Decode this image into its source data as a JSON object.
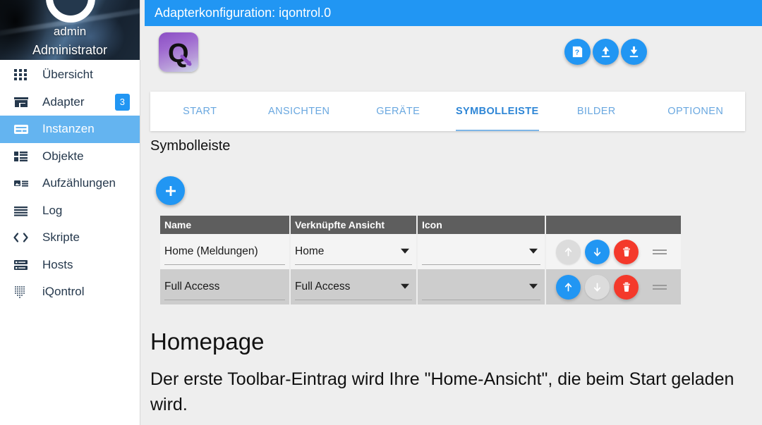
{
  "sidebar": {
    "user": {
      "name": "admin",
      "role": "Administrator"
    },
    "items": [
      {
        "label": "Übersicht",
        "icon": "grid-dots-icon",
        "selected": false,
        "badge": null
      },
      {
        "label": "Adapter",
        "icon": "store-icon",
        "selected": false,
        "badge": "3"
      },
      {
        "label": "Instanzen",
        "icon": "instances-icon",
        "selected": true,
        "badge": null
      },
      {
        "label": "Objekte",
        "icon": "list-blocks-icon",
        "selected": false,
        "badge": null
      },
      {
        "label": "Aufzählungen",
        "icon": "image-list-icon",
        "selected": false,
        "badge": null
      },
      {
        "label": "Log",
        "icon": "lines-icon",
        "selected": false,
        "badge": null
      },
      {
        "label": "Skripte",
        "icon": "code-brackets-icon",
        "selected": false,
        "badge": null
      },
      {
        "label": "Hosts",
        "icon": "server-icon",
        "selected": false,
        "badge": null
      },
      {
        "label": "iQontrol",
        "icon": "iqontrol-dots-icon",
        "selected": false,
        "badge": null
      }
    ]
  },
  "header": {
    "title": "Adapterkonfiguration: iqontrol.0",
    "accent_color": "#2196f3",
    "actions": [
      {
        "name": "help-button",
        "icon": "help-doc-icon"
      },
      {
        "name": "upload-button",
        "icon": "upload-icon"
      },
      {
        "name": "download-button",
        "icon": "download-icon"
      }
    ],
    "adapter_logo": "iqontrol-q-logo"
  },
  "tabs": [
    {
      "label": "START",
      "active": false
    },
    {
      "label": "ANSICHTEN",
      "active": false
    },
    {
      "label": "GERÄTE",
      "active": false
    },
    {
      "label": "SYMBOLLEISTE",
      "active": true
    },
    {
      "label": "BILDER",
      "active": false
    },
    {
      "label": "OPTIONEN",
      "active": false
    }
  ],
  "section": {
    "title": "Symbolleiste",
    "add_button_label": "+"
  },
  "table": {
    "columns": [
      "Name",
      "Verknüpfte Ansicht",
      "Icon",
      ""
    ],
    "rows": [
      {
        "name": "Home (Meldungen)",
        "view": "Home",
        "icon": "",
        "up_enabled": false,
        "down_enabled": true
      },
      {
        "name": "Full Access",
        "view": "Full Access",
        "icon": "",
        "up_enabled": true,
        "down_enabled": false
      }
    ],
    "row_actions": {
      "up": "move-up",
      "down": "move-down",
      "delete": "delete",
      "drag": "drag-handle"
    }
  },
  "content": {
    "heading": "Homepage",
    "paragraph": "Der erste Toolbar-Eintrag wird Ihre \"Home-Ansicht\", die beim Start geladen wird."
  },
  "colors": {
    "accent": "#2196f3",
    "selected_menu": "#64b4f0",
    "delete_red": "#f4392b",
    "table_header": "#5e5e5e",
    "page_bg": "#eeeeee"
  }
}
